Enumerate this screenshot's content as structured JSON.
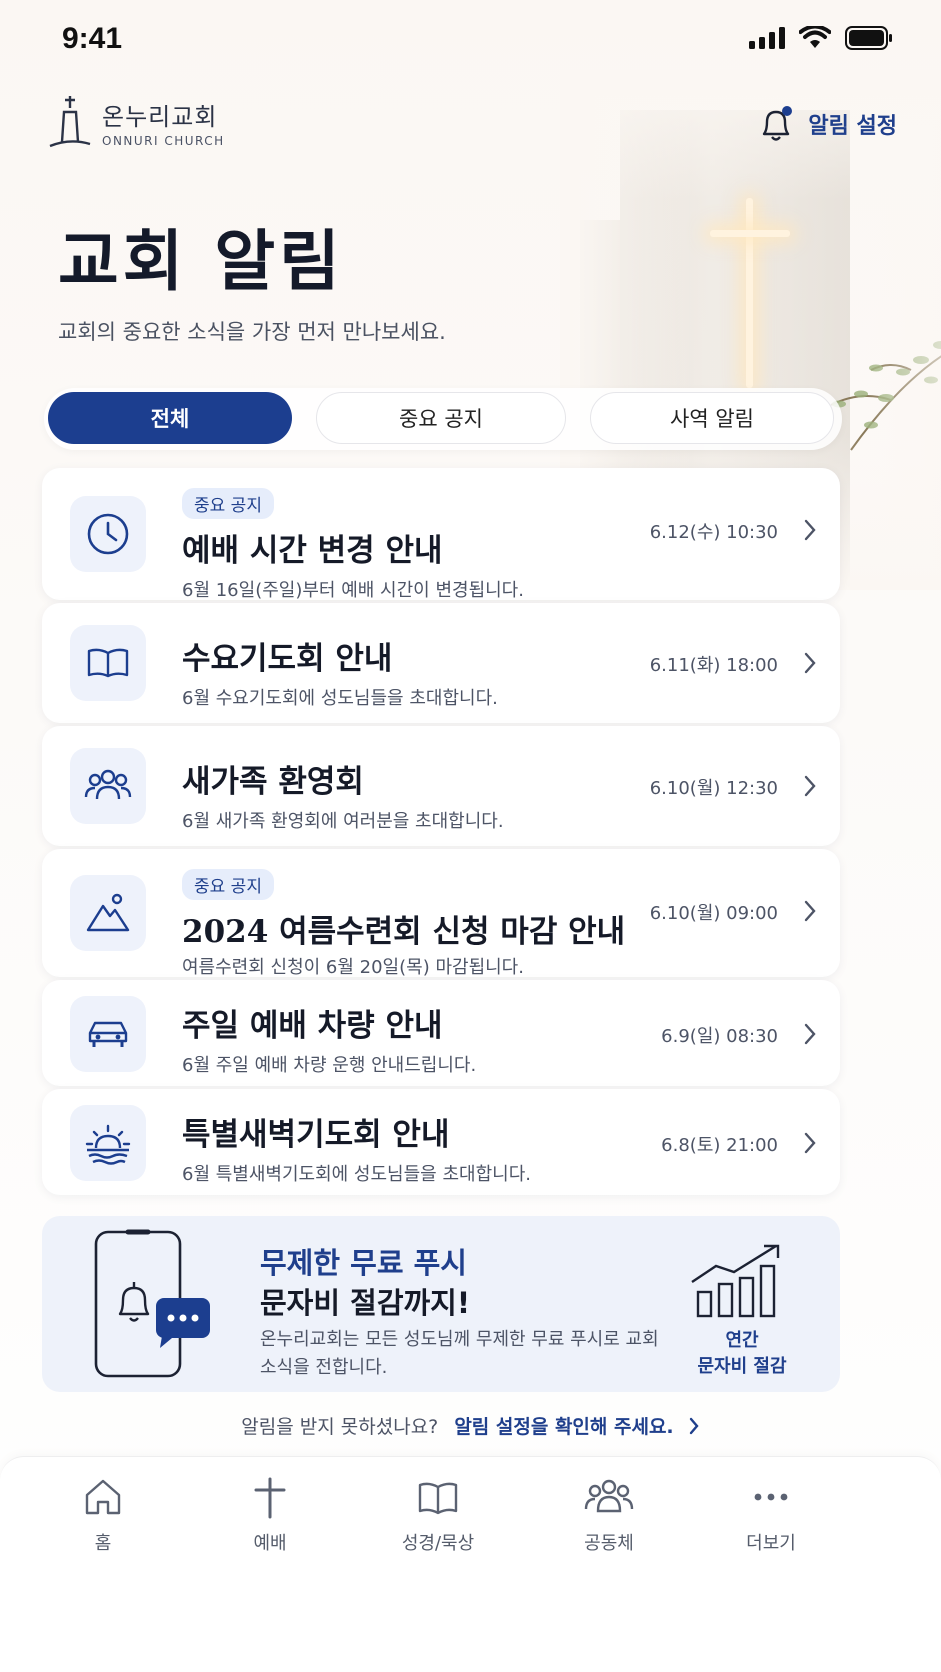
{
  "status_bar": {
    "time": "9:41"
  },
  "header": {
    "logo_ko": "온누리교회",
    "logo_en": "ONNURI CHURCH",
    "alarm_settings_label": "알림 설정"
  },
  "page": {
    "title": "교회 알림",
    "subtitle": "교회의 중요한 소식을 가장 먼저 만나보세요."
  },
  "tabs": [
    {
      "label": "전체",
      "active": true
    },
    {
      "label": "중요 공지",
      "active": false
    },
    {
      "label": "사역 알림",
      "active": false
    }
  ],
  "notices": [
    {
      "badge": "중요 공지",
      "title": "예배 시간 변경 안내",
      "desc": "6월 16일(주일)부터 예배 시간이 변경됩니다.",
      "date": "6.12(수) 10:30",
      "icon": "clock-icon"
    },
    {
      "badge": "",
      "title": "수요기도회 안내",
      "desc": "6월 수요기도회에 성도님들을 초대합니다.",
      "date": "6.11(화) 18:00",
      "icon": "book-icon"
    },
    {
      "badge": "",
      "title": "새가족 환영회",
      "desc": "6월 새가족 환영회에 여러분을 초대합니다.",
      "date": "6.10(월) 12:30",
      "icon": "people-icon"
    },
    {
      "badge": "중요 공지",
      "title": "2024 여름수련회 신청 마감 안내",
      "desc": "여름수련회 신청이 6월 20일(목) 마감됩니다.",
      "date": "6.10(월) 09:00",
      "icon": "mountain-icon"
    },
    {
      "badge": "",
      "title": "주일 예배 차량 안내",
      "desc": "6월 주일 예배 차량 운행 안내드립니다.",
      "date": "6.9(일) 08:30",
      "icon": "car-icon"
    },
    {
      "badge": "",
      "title": "특별새벽기도회 안내",
      "desc": "6월 특별새벽기도회에 성도님들을 초대합니다.",
      "date": "6.8(토) 21:00",
      "icon": "sunrise-icon"
    }
  ],
  "promo": {
    "headline": "무제한 무료 푸시",
    "headline2": "문자비 절감까지!",
    "body": "온누리교회는 모든 성도님께 무제한 무료 푸시로 교회 소식을 전합니다.",
    "stat_line1": "연간",
    "stat_line2": "문자비 절감"
  },
  "help": {
    "question": "알림을 받지 못하셨나요?",
    "link": "알림 설정을 확인해 주세요."
  },
  "bottom_nav": [
    {
      "label": "홈",
      "icon": "home-icon"
    },
    {
      "label": "예배",
      "icon": "cross-icon"
    },
    {
      "label": "성경/묵상",
      "icon": "bible-icon"
    },
    {
      "label": "공동체",
      "icon": "community-icon"
    },
    {
      "label": "더보기",
      "icon": "more-icon"
    }
  ],
  "colors": {
    "primary": "#1c3e8f",
    "accent_light": "#eef2fb",
    "text": "#151a28"
  }
}
